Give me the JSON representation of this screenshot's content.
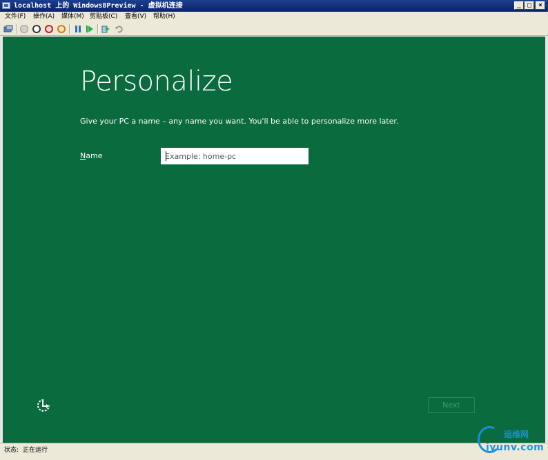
{
  "window": {
    "title": "localhost 上的 Windows8Preview - 虚拟机连接",
    "min_glyph": "_",
    "max_glyph": "□",
    "close_glyph": "×"
  },
  "menu": {
    "items": [
      {
        "label": "文件(F)"
      },
      {
        "label": "操作(A)"
      },
      {
        "label": "媒体(M)"
      },
      {
        "label": "剪贴板(C)"
      },
      {
        "label": "查看(V)"
      },
      {
        "label": "帮助(H)"
      }
    ]
  },
  "toolbar": {
    "icons": [
      "ctrl-alt-del-icon",
      "start-icon",
      "turn-off-icon",
      "shutdown-icon",
      "save-icon",
      "pause-icon",
      "reset-icon",
      "snapshot-icon",
      "revert-icon"
    ]
  },
  "vm": {
    "background": "#0a6b3e",
    "title": "Personalize",
    "subtitle": "Give your PC a name – any name you want. You'll be able to personalize more later.",
    "name_label_access": "N",
    "name_label_rest": "ame",
    "name_input": {
      "value": "",
      "placeholder": "Example: home-pc"
    },
    "next_label": "Next"
  },
  "status": {
    "label": "状态:",
    "value": "正在运行"
  },
  "watermark": {
    "top": "运维网",
    "bottom": "iyunv.com"
  }
}
